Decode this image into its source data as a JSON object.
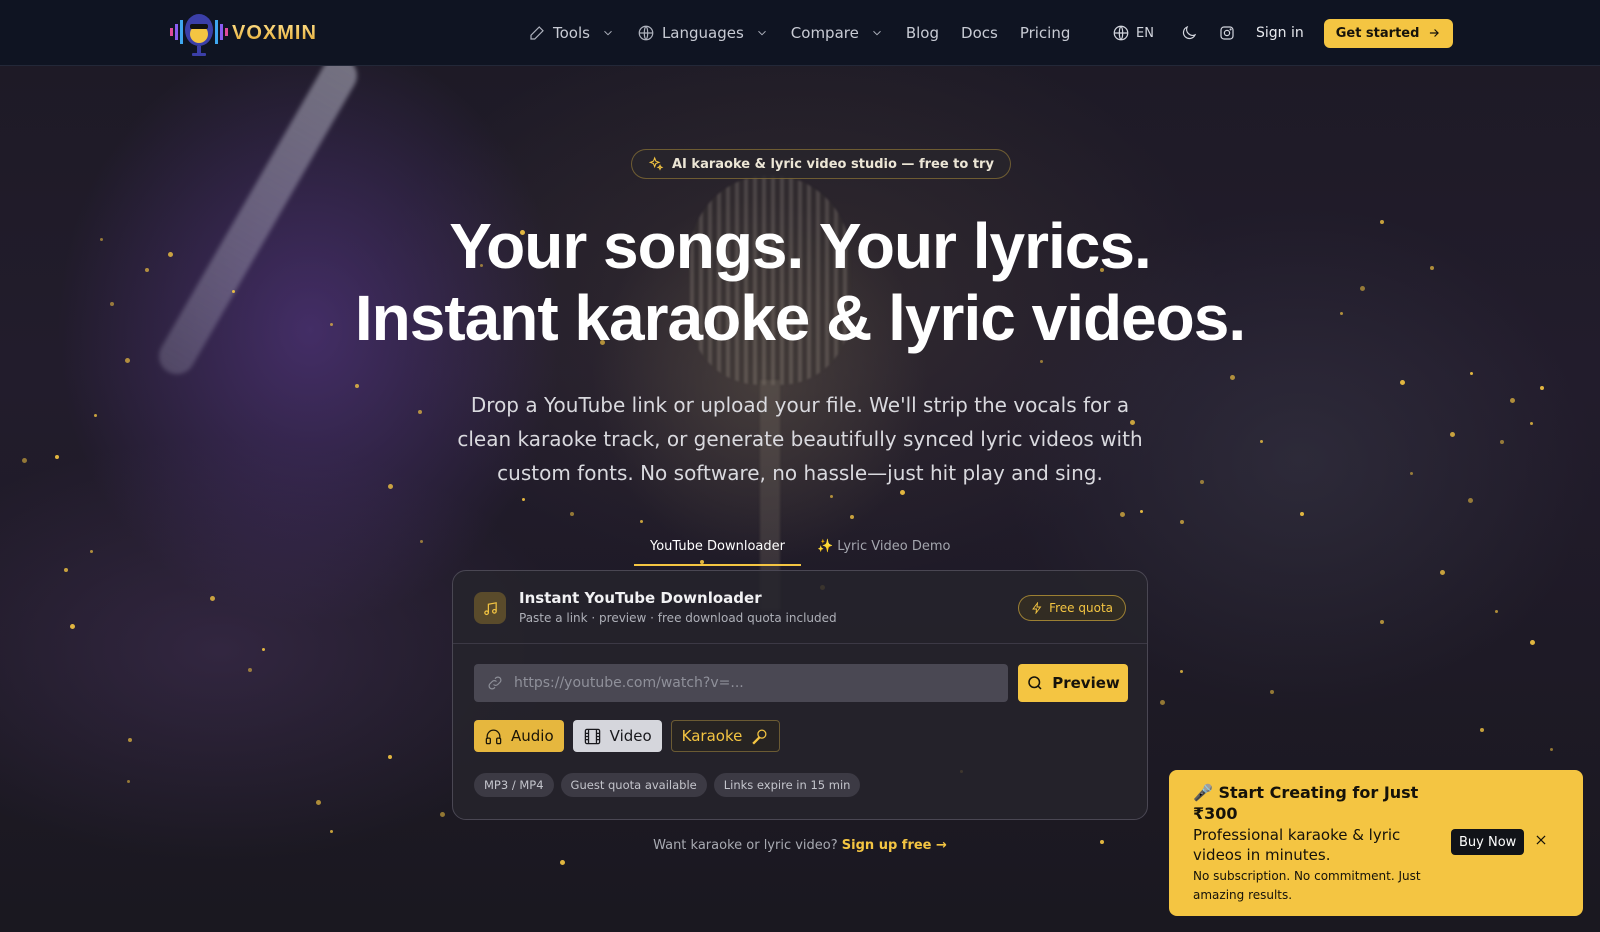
{
  "brand": {
    "name": "VOXMIN"
  },
  "nav": {
    "items": [
      {
        "label": "Tools",
        "icon": "pen-icon",
        "has_dropdown": true
      },
      {
        "label": "Languages",
        "icon": "globe-icon",
        "has_dropdown": true
      },
      {
        "label": "Compare",
        "icon": "",
        "has_dropdown": true
      },
      {
        "label": "Blog"
      },
      {
        "label": "Docs"
      },
      {
        "label": "Pricing"
      }
    ],
    "lang": "EN",
    "sign_in": "Sign in",
    "cta": "Get started"
  },
  "hero": {
    "badge": "AI karaoke & lyric video studio — free to try",
    "title_line1": "Your songs. Your lyrics.",
    "title_line2": "Instant karaoke & lyric videos.",
    "subtitle": "Drop a YouTube link or upload your file. We'll strip the vocals for a clean karaoke track, or generate beautifully synced lyric videos with custom fonts. No software, no hassle—just hit play and sing."
  },
  "tabs": [
    {
      "label": "YouTube Downloader",
      "active": true
    },
    {
      "label": "✨ Lyric Video Demo",
      "active": false
    }
  ],
  "downloader": {
    "title": "Instant YouTube Downloader",
    "subtitle": "Paste a link · preview · free download quota included",
    "quota_badge": "Free quota",
    "input_placeholder": "https://youtube.com/watch?v=...",
    "input_value": "",
    "preview_button": "Preview",
    "modes": [
      "Audio",
      "Video",
      "Karaoke"
    ],
    "chips": [
      "MP3 / MP4",
      "Guest quota available",
      "Links expire in 15 min"
    ]
  },
  "footer_prompt": {
    "text": "Want karaoke or lyric video?",
    "link": "Sign up free →"
  },
  "promo": {
    "title": "🎤 Start Creating for Just ₹300",
    "body": "Professional karaoke & lyric videos in minutes.",
    "note": "No subscription. No commitment. Just amazing results.",
    "button": "Buy Now"
  },
  "colors": {
    "accent": "#f4c542",
    "navbar_bg": "#0f1422",
    "card_bg": "#26242c"
  }
}
